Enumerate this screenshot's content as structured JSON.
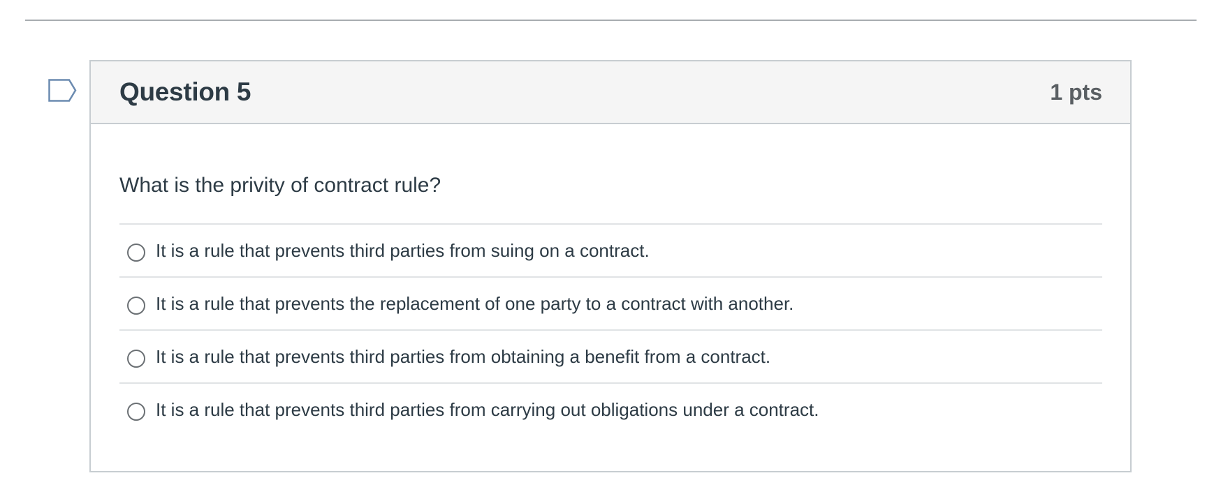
{
  "question": {
    "title": "Question 5",
    "points": "1 pts",
    "text": "What is the privity of contract rule?",
    "answers": [
      {
        "label": "It is a rule that prevents third parties from suing on a contract.",
        "selected": false
      },
      {
        "label": "It is a rule that prevents the replacement of one party to a contract with another.",
        "selected": false
      },
      {
        "label": "It is a rule that prevents third parties from obtaining a benefit from a contract.",
        "selected": false
      },
      {
        "label": "It is a rule that prevents third parties from carrying out obligations under a contract.",
        "selected": false
      }
    ]
  },
  "icons": {
    "flag": "flag-question-icon",
    "radio": "radio-unchecked-icon"
  },
  "colors": {
    "header_bg": "#f5f5f5",
    "border": "#c7cdd1",
    "text": "#2d3b45",
    "flag_stroke": "#6b8bb0"
  }
}
